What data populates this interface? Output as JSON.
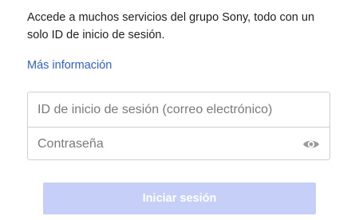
{
  "intro": {
    "text": "Accede a muchos servicios del grupo Sony, todo con un solo ID de inicio de sesión."
  },
  "more_info": {
    "label": "Más información"
  },
  "login_form": {
    "signin_id": {
      "placeholder": "ID de inicio de sesión (correo electrónico)",
      "value": ""
    },
    "password": {
      "placeholder": "Contraseña",
      "value": "",
      "toggle_icon": "eye-icon"
    },
    "submit_label": "Iniciar sesión",
    "submit_enabled": false
  },
  "colors": {
    "link": "#2f5fd0",
    "button_disabled_bg": "#c5cff7",
    "field_border": "#cfcfcf",
    "text": "#1f1f1f"
  }
}
